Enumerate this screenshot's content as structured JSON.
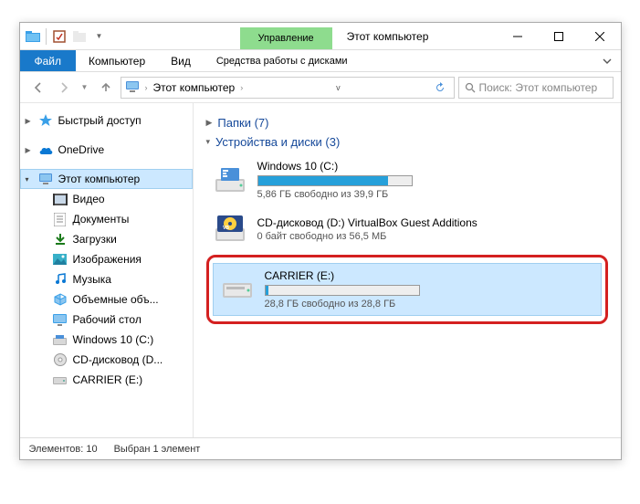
{
  "titlebar": {
    "management_tab": "Управление",
    "window_title": "Этот компьютер"
  },
  "ribbon": {
    "file": "Файл",
    "computer": "Компьютер",
    "view": "Вид",
    "drive_tools": "Средства работы с дисками"
  },
  "address": {
    "location": "Этот компьютер",
    "search_placeholder": "Поиск: Этот компьютер"
  },
  "sidebar": {
    "quick_access": "Быстрый доступ",
    "onedrive": "OneDrive",
    "this_pc": "Этот компьютер",
    "items": [
      {
        "label": "Видео"
      },
      {
        "label": "Документы"
      },
      {
        "label": "Загрузки"
      },
      {
        "label": "Изображения"
      },
      {
        "label": "Музыка"
      },
      {
        "label": "Объемные объ..."
      },
      {
        "label": "Рабочий стол"
      },
      {
        "label": "Windows 10 (C:)"
      },
      {
        "label": "CD-дисковод (D..."
      },
      {
        "label": "CARRIER (E:)"
      }
    ]
  },
  "content": {
    "folders_group": "Папки (7)",
    "drives_group": "Устройства и диски (3)",
    "drive_c": {
      "label": "Windows 10 (C:)",
      "sub": "5,86 ГБ свободно из 39,9 ГБ",
      "fill_pct": 85,
      "fill_color": "#26a0da"
    },
    "drive_d": {
      "label": "CD-дисковод (D:) VirtualBox Guest Additions",
      "sub": "0 байт свободно из 56,5 МБ"
    },
    "drive_e": {
      "label": "CARRIER (E:)",
      "sub": "28,8 ГБ свободно из 28,8 ГБ",
      "fill_pct": 2,
      "fill_color": "#26a0da"
    }
  },
  "statusbar": {
    "elements": "Элементов: 10",
    "selected": "Выбран 1 элемент"
  }
}
